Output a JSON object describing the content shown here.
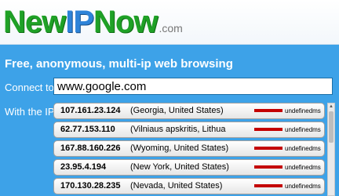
{
  "logo": {
    "new": "New",
    "ip": "IP",
    "now": "Now",
    "dotcom": ".com"
  },
  "tagline": "Free, anonymous, multi-ip web browsing",
  "connect": {
    "label": "Connect to",
    "value": "www.google.com"
  },
  "ip_section": {
    "label": "With the IP",
    "rows": [
      {
        "ip": "107.161.23.124",
        "location": "(Georgia, United States)",
        "ping": "undefinedms"
      },
      {
        "ip": "62.77.153.110",
        "location": "(Vilniaus apskritis, Lithua",
        "ping": "undefinedms"
      },
      {
        "ip": "167.88.160.226",
        "location": "(Wyoming, United States)",
        "ping": "undefinedms"
      },
      {
        "ip": "23.95.4.194",
        "location": "(New York, United States)",
        "ping": "undefinedms"
      },
      {
        "ip": "170.130.28.235",
        "location": "(Nevada, United States)",
        "ping": "undefinedms"
      }
    ]
  },
  "colors": {
    "panel": "#3da2e8",
    "logo_green": "#1fa126",
    "logo_blue": "#2d83d8",
    "ping_bar": "#c40000"
  },
  "icons": {
    "scroll_up": "triangle-up-icon"
  }
}
